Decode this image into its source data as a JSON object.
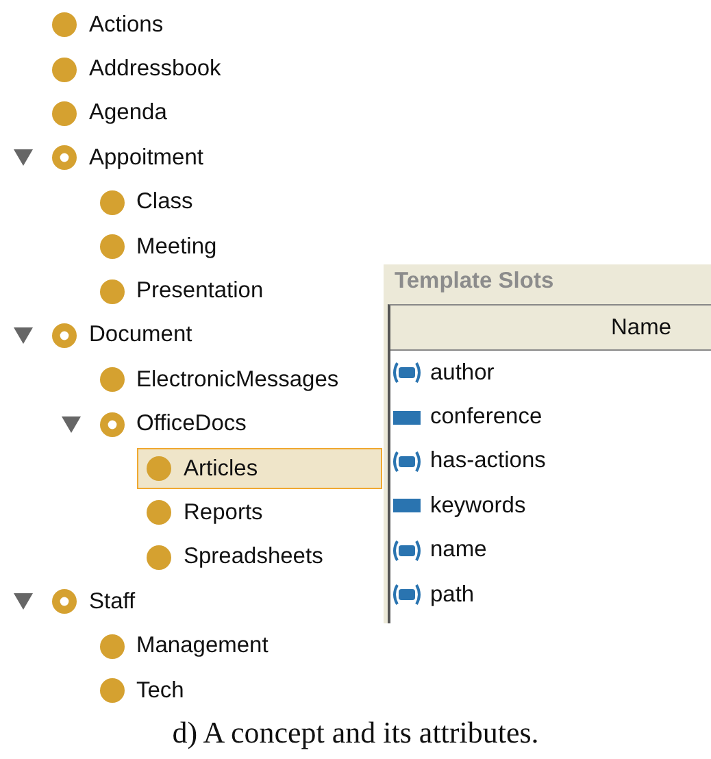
{
  "tree": [
    {
      "label": "Actions",
      "selected": false
    },
    {
      "label": "Addressbook",
      "selected": false
    },
    {
      "label": "Agenda",
      "selected": false
    },
    {
      "label": "Appoitment",
      "selected": false,
      "expanded": true,
      "children": [
        {
          "label": "Class",
          "selected": false
        },
        {
          "label": "Meeting",
          "selected": false
        },
        {
          "label": "Presentation",
          "selected": false
        }
      ]
    },
    {
      "label": "Document",
      "selected": false,
      "expanded": true,
      "children": [
        {
          "label": "ElectronicMessages",
          "selected": false
        },
        {
          "label": "OfficeDocs",
          "selected": false,
          "expanded": true,
          "children": [
            {
              "label": "Articles",
              "selected": true
            },
            {
              "label": "Reports",
              "selected": false
            },
            {
              "label": "Spreadsheets",
              "selected": false
            }
          ]
        }
      ]
    },
    {
      "label": "Staff",
      "selected": false,
      "expanded": true,
      "children": [
        {
          "label": "Management",
          "selected": false
        },
        {
          "label": "Tech",
          "selected": false
        }
      ]
    }
  ],
  "template_slots": {
    "title": "Template Slots",
    "columns": [
      "Name"
    ],
    "rows": [
      {
        "name": "author",
        "kind": "multiple"
      },
      {
        "name": "conference",
        "kind": "single"
      },
      {
        "name": "has-actions",
        "kind": "multiple"
      },
      {
        "name": "keywords",
        "kind": "single"
      },
      {
        "name": "name",
        "kind": "multiple"
      },
      {
        "name": "path",
        "kind": "multiple"
      }
    ]
  },
  "caption": "d) A concept and its attributes."
}
